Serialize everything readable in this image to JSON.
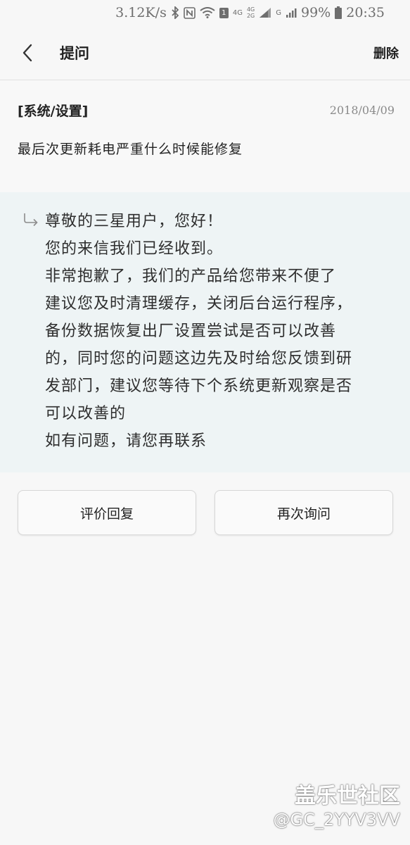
{
  "status_bar": {
    "speed": "3.12K/s",
    "sim1_label": "1",
    "net_4g": "4G",
    "net_4g_2g_top": "4G",
    "net_4g_2g_bottom": "2G",
    "net_g": "G",
    "battery": "99%",
    "time": "20:35",
    "icons": [
      "bluetooth-icon",
      "nfc-icon",
      "wifi-icon",
      "signal-icon",
      "battery-icon"
    ]
  },
  "header": {
    "title": "提问",
    "delete_label": "删除"
  },
  "question": {
    "category": "[系统/设置]",
    "date": "2018/04/09",
    "text": "最后次更新耗电严重什么时候能修复"
  },
  "reply": {
    "lines": [
      "尊敬的三星用户，您好！",
      "您的来信我们已经收到。",
      "非常抱歉了，我们的产品给您带来不便了",
      "建议您及时清理缓存，关闭后台运行程序，",
      "备份数据恢复出厂设置尝试是否可以改善",
      "的，同时您的问题这边先及时给您反馈到研",
      "发部门，建议您等待下个系统更新观察是否",
      "可以改善的",
      "如有问题，请您再联系"
    ]
  },
  "actions": {
    "rate_label": "评价回复",
    "ask_again_label": "再次询问"
  },
  "watermark": {
    "site": "盖乐世社区",
    "user": "@GC_2YYV3VV"
  },
  "colors": {
    "background": "#f7f7f7",
    "reply_background": "#eef4f5",
    "text": "#222222",
    "muted": "#8a8a8a"
  }
}
